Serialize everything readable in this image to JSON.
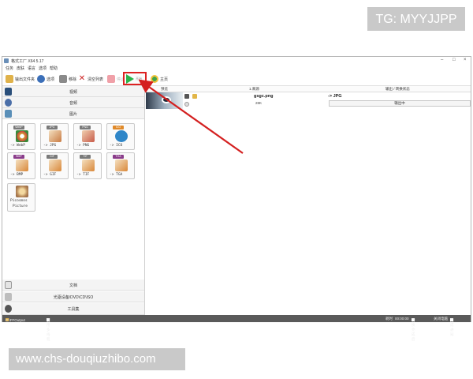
{
  "watermarks": {
    "top": "TG: MYYJJPP",
    "bottom": "www.chs-douqiuzhibo.com"
  },
  "window": {
    "title": "格式工厂 X64 5.17",
    "controls": [
      "–",
      "□",
      "×"
    ]
  },
  "menu": [
    "任务",
    "皮肤",
    "语言",
    "选项",
    "帮助"
  ],
  "toolbar": {
    "output_folder": "输出文件夹",
    "options": "选项",
    "remove": "移除",
    "clear_list": "清空列表",
    "stop": "停止",
    "start": "开始",
    "home": "主页"
  },
  "categories": {
    "video": "视频",
    "audio": "音频",
    "picture": "图片",
    "document": "文档",
    "rom": "光驱设备\\DVD\\CD\\ISO",
    "toolbox": "工具集"
  },
  "formats": [
    {
      "tag": "WebP",
      "label": "-> WebP",
      "tag_color": "#7a7a7a",
      "pic_color": "#d8a23a"
    },
    {
      "tag": "JPG",
      "label": "-> JPG",
      "tag_color": "#7a7a7a",
      "pic_color": "#c87b44"
    },
    {
      "tag": "PNG",
      "label": "-> PNG",
      "tag_color": "#7a7a7a",
      "pic_color": "#c85b4a"
    },
    {
      "tag": "ICO",
      "label": "-> ICO",
      "tag_color": "#e08a2a",
      "pic_color": "#2f86c8"
    },
    {
      "tag": "BMP",
      "label": "-> BMP",
      "tag_color": "#8a3c8a",
      "pic_color": "#d9883a"
    },
    {
      "tag": "GIF",
      "label": "-> GIF",
      "tag_color": "#7a7a7a",
      "pic_color": "#d9883a"
    },
    {
      "tag": "TIF",
      "label": "-> TIF",
      "tag_color": "#7a7a7a",
      "pic_color": "#d9883a"
    },
    {
      "tag": "TGA",
      "label": "-> TGA",
      "tag_color": "#8a3c8a",
      "pic_color": "#d9883a"
    }
  ],
  "extra_format": {
    "label_line1": "Picosmos",
    "label_line2": "Picture"
  },
  "list": {
    "headers": {
      "preview": "预览",
      "source": "1.来源",
      "output": "输出 / 转换状态"
    },
    "rows": [
      {
        "file": "gsgc.png",
        "size": "28K",
        "output": "-> JPG",
        "status": "输出中"
      }
    ]
  },
  "statusbar": {
    "path": "C:\\FFOutput",
    "multi_thread": "使用多线程",
    "elapsed_label": "耗时",
    "elapsed": "00:00:00",
    "shutdown": "转换完成后",
    "action": "关闭电脑",
    "notify": "完成通知"
  }
}
